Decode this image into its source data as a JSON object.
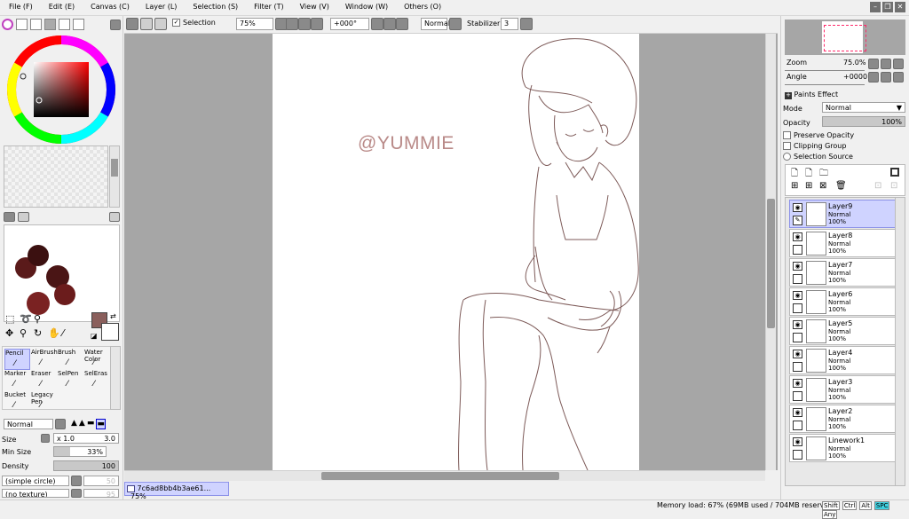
{
  "menu": [
    "File (F)",
    "Edit (E)",
    "Canvas (C)",
    "Layer (L)",
    "Selection (S)",
    "Filter (T)",
    "View (V)",
    "Window (W)",
    "Others (O)"
  ],
  "toolbar": {
    "selection_label": "Selection",
    "zoom_value": "75%",
    "angle_value": "+000°",
    "blend_value": "Normal",
    "stabilizer_label": "Stabilizer",
    "stabilizer_value": "3"
  },
  "canvas": {
    "watermark": "@YUMMIE",
    "line_color": "#7d5a58",
    "watermark_color": "#b98a88"
  },
  "left": {
    "current_color": "#8a5f5c",
    "palette_colors": [
      "#5a1a1a",
      "#3b1010",
      "#4a1515",
      "#7a2222",
      "#6b1c1c"
    ],
    "tools": [
      {
        "label": "Pencil",
        "sel": true
      },
      {
        "label": "AirBrush",
        "sel": false
      },
      {
        "label": "Brush",
        "sel": false
      },
      {
        "label": "Water Color",
        "sel": false
      },
      {
        "label": "Marker",
        "sel": false
      },
      {
        "label": "Eraser",
        "sel": false
      },
      {
        "label": "SelPen",
        "sel": false
      },
      {
        "label": "SelEras",
        "sel": false
      },
      {
        "label": "Bucket",
        "sel": false
      },
      {
        "label": "Legacy Pen",
        "sel": false
      }
    ],
    "brush_mode": "Normal",
    "size_label": "Size",
    "size_multiplier": "x 1.0",
    "size_value": "3.0",
    "min_size_label": "Min Size",
    "min_size_value": "33%",
    "density_label": "Density",
    "density_value": "100",
    "shape_value": "(simple circle)",
    "shape_value_2": "50",
    "texture_value": "(no texture)",
    "texture_value_2": "95"
  },
  "navigator": {
    "zoom_label": "Zoom",
    "zoom_value": "75.0%",
    "angle_label": "Angle",
    "angle_value": "+0000"
  },
  "layer_props": {
    "paints_effect": "Paints Effect",
    "mode_label": "Mode",
    "mode_value": "Normal",
    "opacity_label": "Opacity",
    "opacity_value": "100%",
    "preserve_opacity": "Preserve Opacity",
    "clipping_group": "Clipping Group",
    "selection_source": "Selection Source"
  },
  "layers": [
    {
      "name": "Layer9",
      "mode": "Normal",
      "opacity": "100%",
      "selected": true
    },
    {
      "name": "Layer8",
      "mode": "Normal",
      "opacity": "100%",
      "selected": false
    },
    {
      "name": "Layer7",
      "mode": "Normal",
      "opacity": "100%",
      "selected": false
    },
    {
      "name": "Layer6",
      "mode": "Normal",
      "opacity": "100%",
      "selected": false
    },
    {
      "name": "Layer5",
      "mode": "Normal",
      "opacity": "100%",
      "selected": false
    },
    {
      "name": "Layer4",
      "mode": "Normal",
      "opacity": "100%",
      "selected": false
    },
    {
      "name": "Layer3",
      "mode": "Normal",
      "opacity": "100%",
      "selected": false
    },
    {
      "name": "Layer2",
      "mode": "Normal",
      "opacity": "100%",
      "selected": false
    },
    {
      "name": "Linework1",
      "mode": "Normal",
      "opacity": "100%",
      "selected": false
    }
  ],
  "document_tab": {
    "name": "7c6ad8bb4b3ae61...",
    "zoom": "75%"
  },
  "status": {
    "memory": "Memory load: 67% (69MB used / 704MB reserved)",
    "keys": [
      "Shift",
      "Ctrl",
      "Alt",
      "SPC",
      "Any"
    ]
  }
}
